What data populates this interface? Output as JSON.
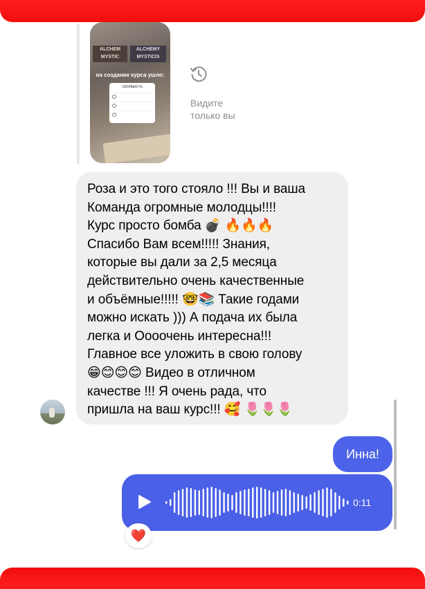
{
  "story_reply": {
    "overlay_text": "на создание курса ушло:",
    "card_title": "СКОЛЬКО %",
    "card_rows": [
      "",
      "",
      ""
    ],
    "book_left": "ALCHEM\nMYSTIC",
    "book_right": "ALCHEMY\nMYSTICIS",
    "seen_label": "Видите\nтолько вы"
  },
  "incoming_message": {
    "text": "Роза и это того стояло !!! Вы и ваша\nКоманда огромные молодцы!!!!\nКурс просто бомба 💣 🔥🔥🔥\nСпасибо Вам всем!!!!! Знания,\nкоторые вы дали за 2,5 месяца\nдействительно очень качественные\nи объёмные!!!!! 🤓📚 Такие годами\nможно искать ))) А подача их была\nлегка и Оооочень интересна!!!\nГлавное все уложить в свою голову\n😁😊😊😊 Видео в отличном\nкачестве !!! Я очень рада, что\nпришла на ваш курс!!! 🥰 🌷🌷🌷"
  },
  "outgoing_message": {
    "text": "Инна!"
  },
  "voice_message": {
    "duration": "0:11",
    "progress": 0
  },
  "reaction": {
    "emoji": "❤️"
  },
  "colors": {
    "frame_red": "#f20d0d",
    "incoming_bubble": "#efefef",
    "outgoing_bubble": "#4c62e8",
    "seen_gray": "#8e8e8e"
  },
  "icons": [
    "history-icon",
    "play-icon",
    "waveform-icon",
    "heart-icon"
  ]
}
